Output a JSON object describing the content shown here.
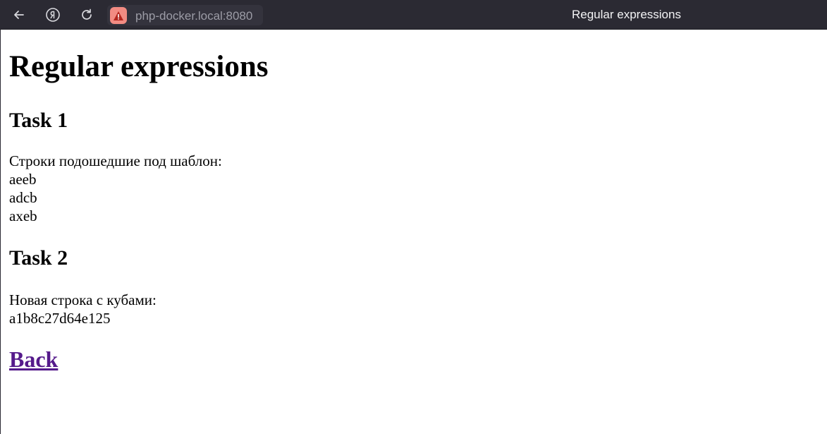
{
  "browser": {
    "address": "php-docker.local:8080",
    "tab_title": "Regular expressions",
    "icons": {
      "back": "back-arrow-icon",
      "yandex": "yandex-icon",
      "reload": "reload-icon",
      "security": "warning-triangle-icon"
    },
    "security_color": "#f28b82"
  },
  "page": {
    "title": "Regular expressions",
    "task1": {
      "heading": "Task 1",
      "label": "Строки подошедшие под шаблон:",
      "matches": [
        "aeeb",
        "adcb",
        "axeb"
      ]
    },
    "task2": {
      "heading": "Task 2",
      "label": "Новая строка с кубами:",
      "result": "a1b8c27d64e125"
    },
    "back_link": "Back",
    "link_color": "#551a8b"
  }
}
